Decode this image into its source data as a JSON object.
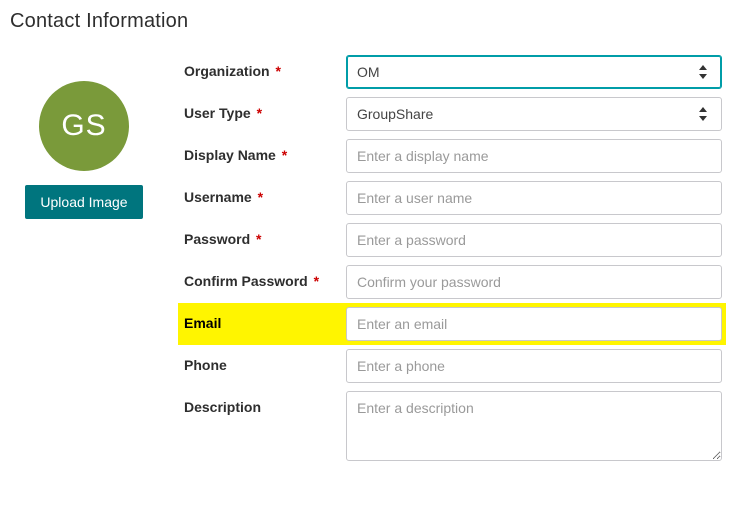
{
  "heading": "Contact Information",
  "avatar": {
    "initials": "GS"
  },
  "upload_button_label": "Upload Image",
  "fields": {
    "organization": {
      "label": "Organization",
      "required_mark": "*",
      "value": "OM"
    },
    "user_type": {
      "label": "User Type",
      "required_mark": "*",
      "value": "GroupShare"
    },
    "display_name": {
      "label": "Display Name",
      "required_mark": "*",
      "placeholder": "Enter a display name"
    },
    "username": {
      "label": "Username",
      "required_mark": "*",
      "placeholder": "Enter a user name"
    },
    "password": {
      "label": "Password",
      "required_mark": "*",
      "placeholder": "Enter a password"
    },
    "confirm_password": {
      "label": "Confirm Password",
      "required_mark": "*",
      "placeholder": "Confirm your password"
    },
    "email": {
      "label": "Email",
      "placeholder": "Enter an email"
    },
    "phone": {
      "label": "Phone",
      "placeholder": "Enter a phone"
    },
    "description": {
      "label": "Description",
      "placeholder": "Enter a description"
    }
  }
}
